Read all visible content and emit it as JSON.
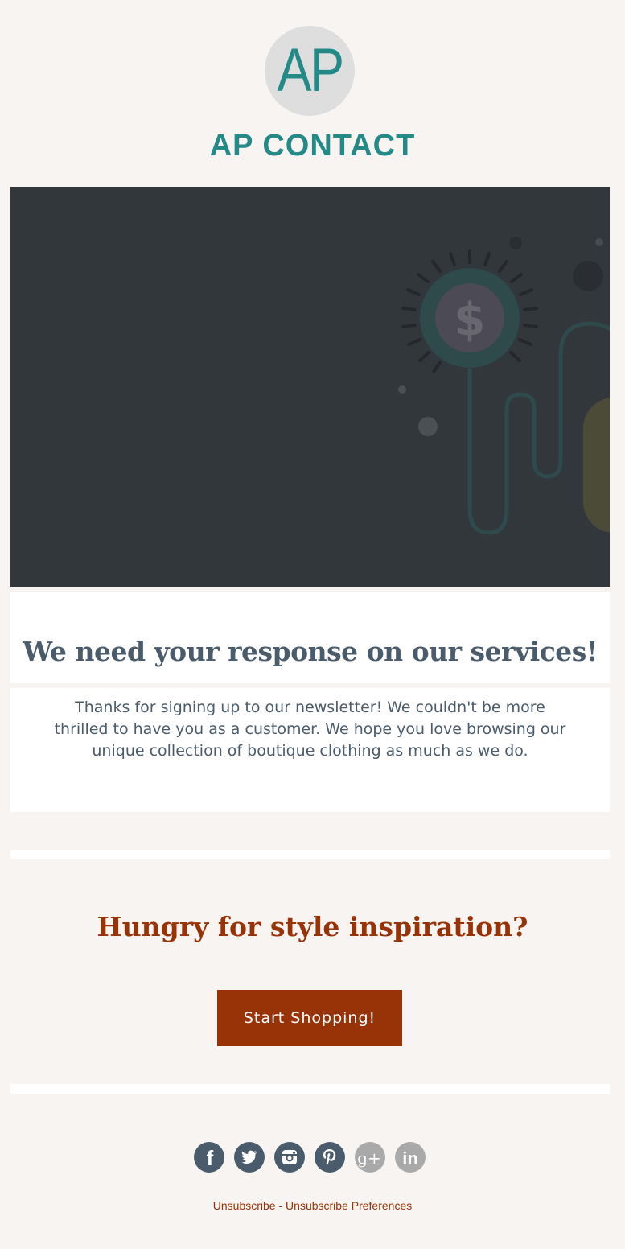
{
  "header": {
    "logo_text": "AP",
    "brand_name": "AP CONTACT"
  },
  "hero": {
    "icon": "dollar-coin-icon"
  },
  "main": {
    "headline": "We need your response on our services!",
    "body": "Thanks for signing up to our newsletter! We couldn't be more thrilled to have you as a customer. We hope you love browsing our unique collection of boutique clothing as much as we do."
  },
  "promo": {
    "heading": "Hungry for style inspiration?",
    "cta_label": "Start Shopping!"
  },
  "social": [
    {
      "name": "facebook-icon",
      "letter": "f"
    },
    {
      "name": "twitter-icon",
      "letter": ""
    },
    {
      "name": "instagram-icon",
      "letter": ""
    },
    {
      "name": "pinterest-icon",
      "letter": "p"
    },
    {
      "name": "google-plus-icon",
      "letter": "g+"
    },
    {
      "name": "linkedin-icon",
      "letter": "in"
    }
  ],
  "footer": {
    "unsubscribe": "Unsubscribe",
    "separator": " - ",
    "preferences": "Unsubscribe Preferences"
  },
  "colors": {
    "background": "#f8f4f1",
    "teal": "#248a88",
    "slate": "#4a5c6b",
    "rust": "#983307",
    "hero_bg": "#32373c",
    "social_dark": "#4a5c6b",
    "social_light": "#a9a9a9"
  }
}
